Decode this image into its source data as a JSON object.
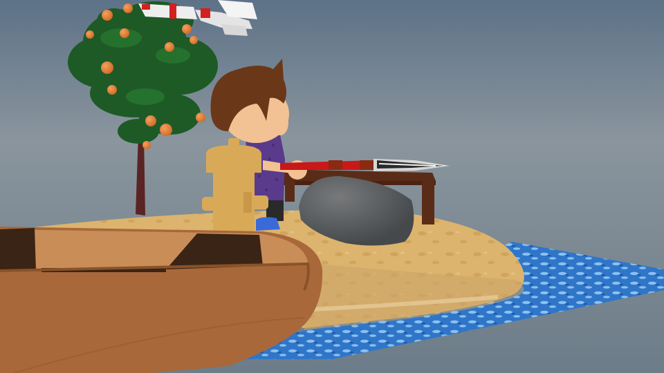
{
  "scene": {
    "colors": {
      "sky_top": "#5d7287",
      "sky_horizon": "#8d979f",
      "ground_far": "#74848f",
      "ground_near": "#6c7c88",
      "sand": "#dcb46e",
      "sand_shadow": "#c79a52",
      "water": "#2f76c9",
      "water_light": "#8cc0f0",
      "boat_outer": "#a8683a",
      "boat_inner": "#c98d58",
      "boat_dark": "#3a2416",
      "tree_leaves": "#1d5a26",
      "tree_trunk": "#5a2424",
      "orange_fruit": "#e07b33",
      "hydrant": "#d8aa58",
      "rock": "#565a5c",
      "table": "#5a2c18",
      "spear_shaft": "#c81818",
      "spear_blade": "#d8d8d8",
      "hair": "#6a3818",
      "skin": "#f2c294",
      "shirt": "#5a3a8a",
      "shoe": "#3a6ad8",
      "drone_white": "#eeeeee",
      "drone_red": "#d42020"
    }
  }
}
